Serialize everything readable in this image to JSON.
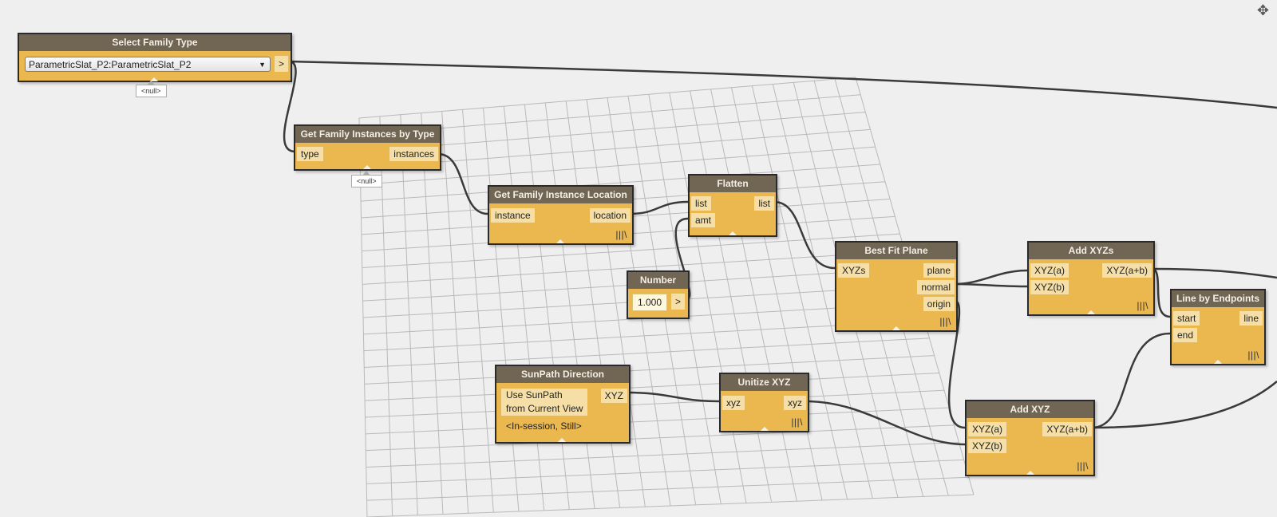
{
  "colors": {
    "node_body": "#eab84e",
    "node_header": "#716553",
    "port_bg": "#f5dfa6",
    "wire": "#3a3a3a",
    "background": "#efefef",
    "grid": "#b9b9b9"
  },
  "nodes": {
    "select_family_type": {
      "title": "Select Family Type",
      "dropdown_value": "ParametricSlat_P2:ParametricSlat_P2",
      "output": ">",
      "preview": "<null>"
    },
    "get_instances": {
      "title": "Get Family Instances by Type",
      "input": "type",
      "output": "instances",
      "preview": "<null>"
    },
    "get_location": {
      "title": "Get Family Instance Location",
      "input": "instance",
      "output": "location",
      "lacing": "|||\\"
    },
    "flatten": {
      "title": "Flatten",
      "inputs": [
        "list",
        "amt"
      ],
      "output": "list"
    },
    "number": {
      "title": "Number",
      "value": "1.000",
      "output": ">"
    },
    "best_fit_plane": {
      "title": "Best Fit Plane",
      "input": "XYZs",
      "outputs": [
        "plane",
        "normal",
        "origin"
      ],
      "lacing": "|||\\"
    },
    "add_xyzs": {
      "title": "Add XYZs",
      "inputs": [
        "XYZ(a)",
        "XYZ(b)"
      ],
      "output": "XYZ(a+b)",
      "lacing": "|||\\"
    },
    "line_by_endpoints": {
      "title": "Line by Endpoints",
      "inputs": [
        "start",
        "end"
      ],
      "output": "line",
      "lacing": "|||\\"
    },
    "sunpath_direction": {
      "title": "SunPath Direction",
      "label_line1": "Use SunPath",
      "label_line2": "from Current View",
      "status": "<In-session, Still>",
      "output": "XYZ"
    },
    "unitize_xyz": {
      "title": "Unitize XYZ",
      "input": "xyz",
      "output": "xyz",
      "lacing": "|||\\"
    },
    "add_xyz": {
      "title": "Add XYZ",
      "inputs": [
        "XYZ(a)",
        "XYZ(b)"
      ],
      "output": "XYZ(a+b)",
      "lacing": "|||\\"
    }
  },
  "icons": {
    "pan": "move-icon",
    "dropdown": "chevron-down-icon"
  }
}
